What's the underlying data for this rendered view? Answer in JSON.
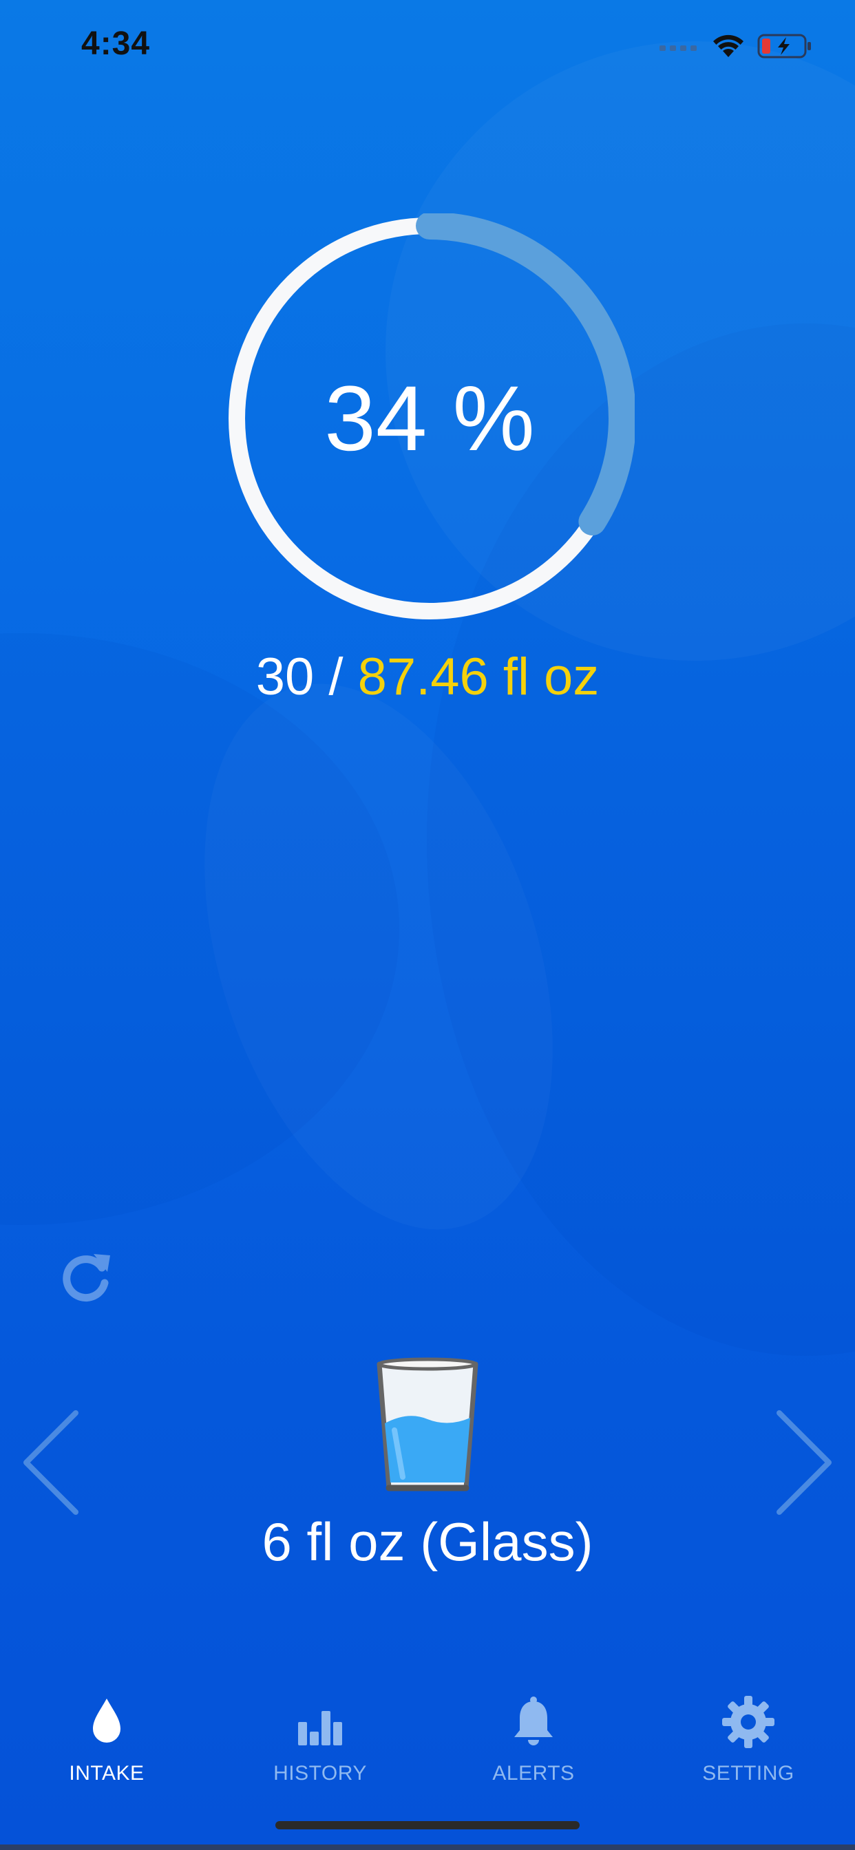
{
  "status_bar": {
    "time": "4:34"
  },
  "progress": {
    "percent_text": "34 %",
    "fraction": 0.34
  },
  "intake": {
    "consumed": "30",
    "separator": " / ",
    "goal": "87.46 fl oz"
  },
  "cup": {
    "label": "6 fl oz (Glass)"
  },
  "tabs": [
    {
      "label": "INTAKE",
      "icon": "water-drop-icon",
      "active": true
    },
    {
      "label": "HISTORY",
      "icon": "bar-chart-icon",
      "active": false
    },
    {
      "label": "ALERTS",
      "icon": "bell-icon",
      "active": false
    },
    {
      "label": "SETTING",
      "icon": "gear-icon",
      "active": false
    }
  ],
  "colors": {
    "background_top": "#0a79e6",
    "background_bottom": "#0552d8",
    "goal_yellow": "#f5d10b",
    "ring_track": "#f7f8fa",
    "ring_progress": "#5ba0dc",
    "tab_active": "#ffffff",
    "tab_inactive": "#8fb9f0",
    "glass_water": "#3aa9f5"
  }
}
